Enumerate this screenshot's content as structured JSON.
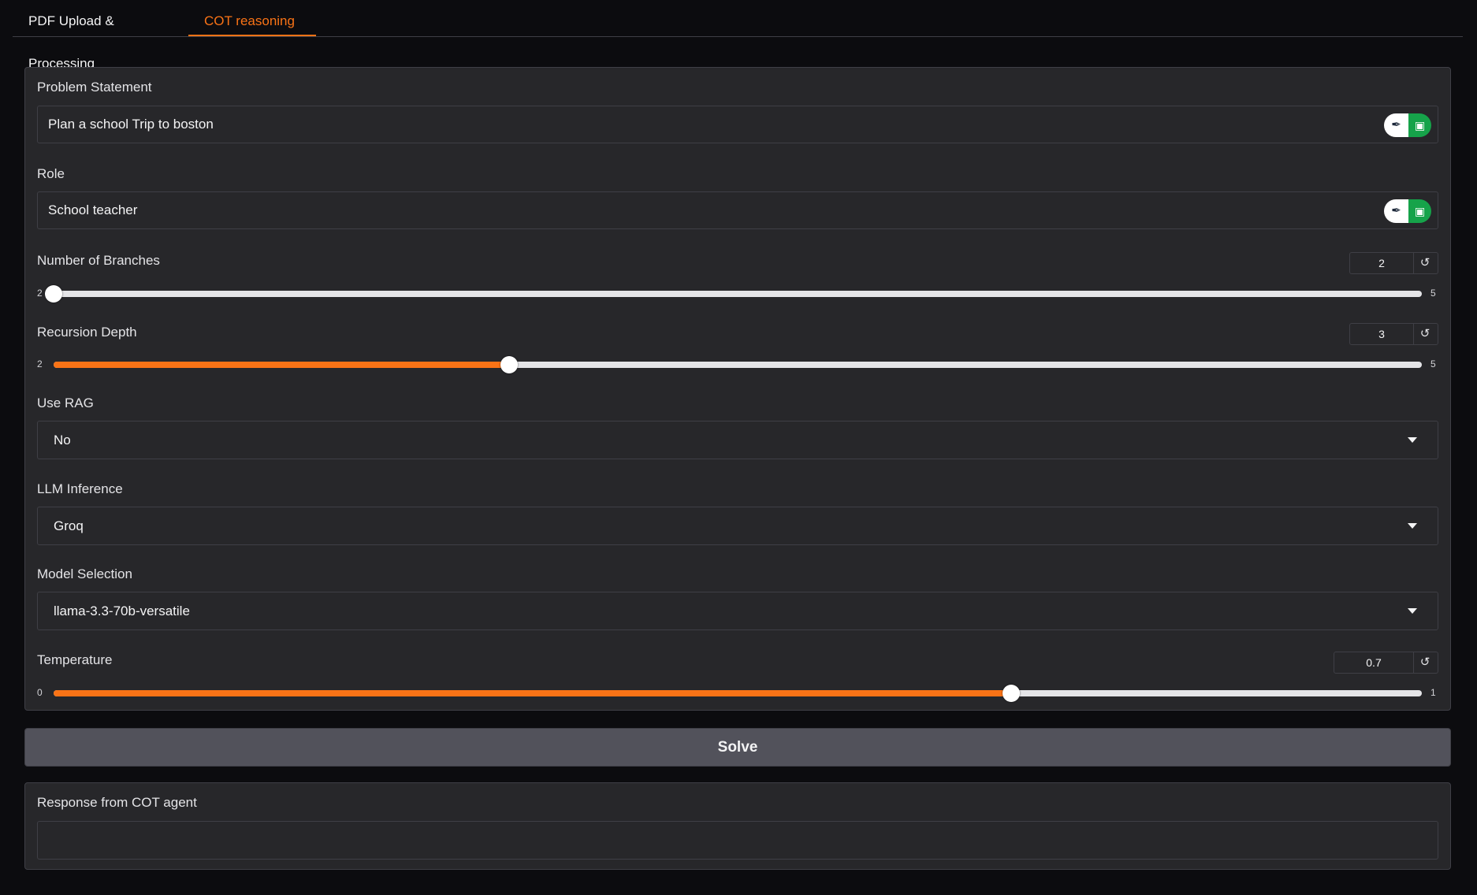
{
  "tabs": [
    {
      "label": "PDF Upload & Processing",
      "active": false
    },
    {
      "label": "COT reasoning",
      "active": true
    }
  ],
  "colors": {
    "accent": "#f97316",
    "panel": "#27272a",
    "background": "#0c0c0f",
    "button": "#52525b"
  },
  "problem": {
    "label": "Problem Statement",
    "value": "Plan a school Trip to boston",
    "icons": [
      "feather-icon",
      "robot-icon"
    ]
  },
  "role": {
    "label": "Role",
    "value": "School teacher",
    "icons": [
      "feather-icon",
      "robot-icon"
    ]
  },
  "branches": {
    "label": "Number of Branches",
    "value": "2",
    "min": "2",
    "max": "5",
    "fraction": 0.0
  },
  "depth": {
    "label": "Recursion Depth",
    "value": "3",
    "min": "2",
    "max": "5",
    "fraction": 0.333
  },
  "rag": {
    "label": "Use RAG",
    "value": "No"
  },
  "llm": {
    "label": "LLM Inference",
    "value": "Groq"
  },
  "model": {
    "label": "Model Selection",
    "value": "llama-3.3-70b-versatile"
  },
  "temperature": {
    "label": "Temperature",
    "value": "0.7",
    "min": "0",
    "max": "1",
    "fraction": 0.7
  },
  "solve": {
    "label": "Solve"
  },
  "response": {
    "label": "Response from COT agent",
    "value": ""
  }
}
